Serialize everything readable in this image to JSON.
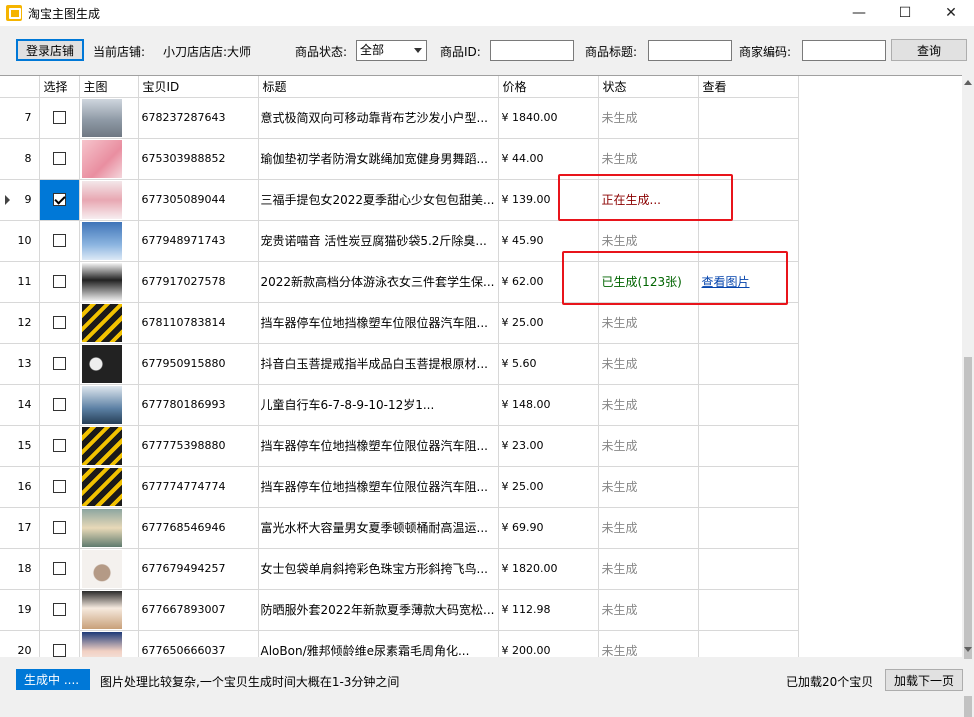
{
  "window": {
    "title": "淘宝主图生成",
    "minimize": "—",
    "maximize": "☐",
    "close": "✕"
  },
  "toolbar": {
    "login_label": "登录店铺",
    "current_store_label": "当前店铺:",
    "current_store_value": "小刀店店店:大师",
    "status_label": "商品状态:",
    "status_selected": "全部",
    "id_label": "商品ID:",
    "id_value": "",
    "title_label": "商品标题:",
    "title_value": "",
    "code_label": "商家编码:",
    "code_value": "",
    "query_label": "查询"
  },
  "table": {
    "columns": [
      "选择",
      "主图",
      "宝贝ID",
      "标题",
      "价格",
      "状态",
      "查看"
    ],
    "rows": [
      {
        "num": "7",
        "checked": false,
        "id": "678237287643",
        "title": "意式极简双向可移动靠背布艺沙发小户型...",
        "price": "¥ 1840.00",
        "status": "未生成",
        "status_type": "none",
        "view": "",
        "thumb": "sofa"
      },
      {
        "num": "8",
        "checked": false,
        "id": "675303988852",
        "title": "瑜伽垫初学者防滑女跳绳加宽健身男舞蹈...",
        "price": "¥ 44.00",
        "status": "未生成",
        "status_type": "none",
        "view": "",
        "thumb": "yoga"
      },
      {
        "num": "9",
        "checked": true,
        "id": "677305089044",
        "title": "三福手提包女2022夏季甜心少女包包甜美...",
        "price": "¥ 139.00",
        "status": "正在生成...",
        "status_type": "gen",
        "view": "",
        "thumb": "bag",
        "current": true
      },
      {
        "num": "10",
        "checked": false,
        "id": "677948971743",
        "title": "宠贵诺喵音 活性炭豆腐猫砂袋5.2斤除臭...",
        "price": "¥ 45.90",
        "status": "未生成",
        "status_type": "none",
        "view": "",
        "thumb": "cat"
      },
      {
        "num": "11",
        "checked": false,
        "id": "677917027578",
        "title": "2022新款高档分体游泳衣女三件套学生保...",
        "price": "¥ 62.00",
        "status": "已生成(123张)",
        "status_type": "done",
        "view": "查看图片",
        "thumb": "swim"
      },
      {
        "num": "12",
        "checked": false,
        "id": "678110783814",
        "title": "挡车器停车位地挡橡塑车位限位器汽车阻...",
        "price": "¥ 25.00",
        "status": "未生成",
        "status_type": "none",
        "view": "",
        "thumb": "stopper"
      },
      {
        "num": "13",
        "checked": false,
        "id": "677950915880",
        "title": "抖音白玉菩提戒指半成品白玉菩提根原材...",
        "price": "¥ 5.60",
        "status": "未生成",
        "status_type": "none",
        "view": "",
        "thumb": "ring"
      },
      {
        "num": "14",
        "checked": false,
        "id": "677780186993",
        "title": "儿童自行车6-7-8-9-10-12岁1...",
        "price": "¥ 148.00",
        "status": "未生成",
        "status_type": "none",
        "view": "",
        "thumb": "bike"
      },
      {
        "num": "15",
        "checked": false,
        "id": "677775398880",
        "title": "挡车器停车位地挡橡塑车位限位器汽车阻...",
        "price": "¥ 23.00",
        "status": "未生成",
        "status_type": "none",
        "view": "",
        "thumb": "stopper"
      },
      {
        "num": "16",
        "checked": false,
        "id": "677774774774",
        "title": "挡车器停车位地挡橡塑车位限位器汽车阻...",
        "price": "¥ 25.00",
        "status": "未生成",
        "status_type": "none",
        "view": "",
        "thumb": "stopper"
      },
      {
        "num": "17",
        "checked": false,
        "id": "677768546946",
        "title": "富光水杯大容量男女夏季顿顿桶耐高温运...",
        "price": "¥ 69.90",
        "status": "未生成",
        "status_type": "none",
        "view": "",
        "thumb": "cup"
      },
      {
        "num": "18",
        "checked": false,
        "id": "677679494257",
        "title": "女士包袋单肩斜挎彩色珠宝方形斜挎飞鸟...",
        "price": "¥ 1820.00",
        "status": "未生成",
        "status_type": "none",
        "view": "",
        "thumb": "purse"
      },
      {
        "num": "19",
        "checked": false,
        "id": "677667893007",
        "title": "防晒服外套2022年新款夏季薄款大码宽松...",
        "price": "¥ 112.98",
        "status": "未生成",
        "status_type": "none",
        "view": "",
        "thumb": "coat"
      },
      {
        "num": "20",
        "checked": false,
        "id": "677650666037",
        "title": "AloBon/雅邦倾龄维e尿素霜毛周角化...",
        "price": "¥ 200.00",
        "status": "未生成",
        "status_type": "none",
        "view": "",
        "thumb": "cream"
      }
    ]
  },
  "statusbar": {
    "generating_label": "生成中 ....",
    "message": "图片处理比较复杂,一个宝贝生成时间大概在1-3分钟之间",
    "loaded_text": "已加载20个宝贝",
    "next_page_label": "加载下一页"
  },
  "colors": {
    "accent": "#0078d7",
    "highlight_box": "#e8141b",
    "status_generating": "#8b0000",
    "status_done": "#006400",
    "status_pending": "#888888"
  }
}
